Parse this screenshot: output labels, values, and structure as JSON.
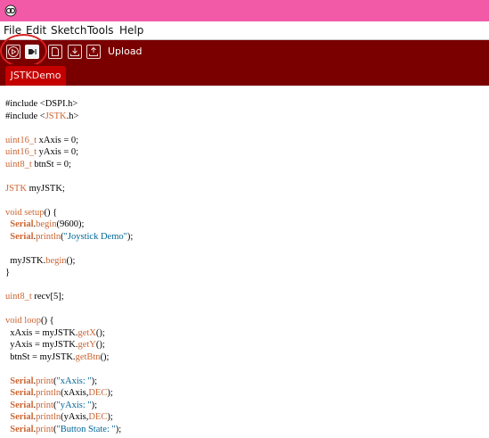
{
  "titlebar": {
    "logo_icon": "app-logo-icon"
  },
  "menubar": {
    "items": [
      {
        "label": "File"
      },
      {
        "label": "Edit"
      },
      {
        "label": "Sketch"
      },
      {
        "label": "Tools"
      },
      {
        "label": "Help"
      }
    ]
  },
  "toolbar": {
    "buttons": [
      {
        "icon": "play-icon"
      },
      {
        "icon": "stop-icon"
      },
      {
        "icon": "new-file-icon"
      },
      {
        "icon": "open-icon"
      },
      {
        "icon": "save-icon"
      }
    ],
    "status_label": "Upload",
    "accent_color": "#7a0000",
    "highlight_color": "#d92020"
  },
  "tabs": [
    {
      "label": "JSTKDemo"
    }
  ],
  "code": {
    "lines": [
      [
        {
          "t": "#include <DSPI.h>",
          "c": "dir"
        }
      ],
      [
        {
          "t": "#include <",
          "c": "dir"
        },
        {
          "t": "JSTK",
          "c": "kw-class"
        },
        {
          "t": ".h>",
          "c": "dir"
        }
      ],
      [],
      [
        {
          "t": "uint16_t",
          "c": "kw-type"
        },
        {
          "t": " xAxis = 0;",
          "c": ""
        }
      ],
      [
        {
          "t": "uint16_t",
          "c": "kw-type"
        },
        {
          "t": " yAxis = 0;",
          "c": ""
        }
      ],
      [
        {
          "t": "uint8_t",
          "c": "kw-type"
        },
        {
          "t": " btnSt = 0;",
          "c": ""
        }
      ],
      [],
      [
        {
          "t": "JSTK",
          "c": "kw-class"
        },
        {
          "t": " myJSTK;",
          "c": ""
        }
      ],
      [],
      [
        {
          "t": "void",
          "c": "kw-type"
        },
        {
          "t": " ",
          "c": ""
        },
        {
          "t": "setup",
          "c": "kw-func"
        },
        {
          "t": "() {",
          "c": ""
        }
      ],
      [
        {
          "t": "  ",
          "c": ""
        },
        {
          "t": "Serial",
          "c": "kw-bold"
        },
        {
          "t": ".",
          "c": ""
        },
        {
          "t": "begin",
          "c": "kw-func"
        },
        {
          "t": "(9600);",
          "c": ""
        }
      ],
      [
        {
          "t": "  ",
          "c": ""
        },
        {
          "t": "Serial",
          "c": "kw-bold"
        },
        {
          "t": ".",
          "c": ""
        },
        {
          "t": "println",
          "c": "kw-func"
        },
        {
          "t": "(",
          "c": ""
        },
        {
          "t": "\"Joystick Demo\"",
          "c": "str"
        },
        {
          "t": ");",
          "c": ""
        }
      ],
      [],
      [
        {
          "t": "  myJSTK.",
          "c": ""
        },
        {
          "t": "begin",
          "c": "kw-func"
        },
        {
          "t": "();",
          "c": ""
        }
      ],
      [
        {
          "t": "}",
          "c": ""
        }
      ],
      [],
      [
        {
          "t": "uint8_t",
          "c": "kw-type"
        },
        {
          "t": " recv[5];",
          "c": ""
        }
      ],
      [],
      [
        {
          "t": "void",
          "c": "kw-type"
        },
        {
          "t": " ",
          "c": ""
        },
        {
          "t": "loop",
          "c": "kw-func"
        },
        {
          "t": "() {",
          "c": ""
        }
      ],
      [
        {
          "t": "  xAxis = myJSTK.",
          "c": ""
        },
        {
          "t": "getX",
          "c": "kw-func"
        },
        {
          "t": "();",
          "c": ""
        }
      ],
      [
        {
          "t": "  yAxis = myJSTK.",
          "c": ""
        },
        {
          "t": "getY",
          "c": "kw-func"
        },
        {
          "t": "();",
          "c": ""
        }
      ],
      [
        {
          "t": "  btnSt = myJSTK.",
          "c": ""
        },
        {
          "t": "getBtn",
          "c": "kw-func"
        },
        {
          "t": "();",
          "c": ""
        }
      ],
      [],
      [
        {
          "t": "  ",
          "c": ""
        },
        {
          "t": "Serial",
          "c": "kw-bold"
        },
        {
          "t": ".",
          "c": ""
        },
        {
          "t": "print",
          "c": "kw-func"
        },
        {
          "t": "(",
          "c": ""
        },
        {
          "t": "\"xAxis: \"",
          "c": "str"
        },
        {
          "t": ");",
          "c": ""
        }
      ],
      [
        {
          "t": "  ",
          "c": ""
        },
        {
          "t": "Serial",
          "c": "kw-bold"
        },
        {
          "t": ".",
          "c": ""
        },
        {
          "t": "println",
          "c": "kw-func"
        },
        {
          "t": "(xAxis,",
          "c": ""
        },
        {
          "t": "DEC",
          "c": "kw-type"
        },
        {
          "t": ");",
          "c": ""
        }
      ],
      [
        {
          "t": "  ",
          "c": ""
        },
        {
          "t": "Serial",
          "c": "kw-bold"
        },
        {
          "t": ".",
          "c": ""
        },
        {
          "t": "print",
          "c": "kw-func"
        },
        {
          "t": "(",
          "c": ""
        },
        {
          "t": "\"yAxis: \"",
          "c": "str"
        },
        {
          "t": ");",
          "c": ""
        }
      ],
      [
        {
          "t": "  ",
          "c": ""
        },
        {
          "t": "Serial",
          "c": "kw-bold"
        },
        {
          "t": ".",
          "c": ""
        },
        {
          "t": "println",
          "c": "kw-func"
        },
        {
          "t": "(yAxis,",
          "c": ""
        },
        {
          "t": "DEC",
          "c": "kw-type"
        },
        {
          "t": ");",
          "c": ""
        }
      ],
      [
        {
          "t": "  ",
          "c": ""
        },
        {
          "t": "Serial",
          "c": "kw-bold"
        },
        {
          "t": ".",
          "c": ""
        },
        {
          "t": "print",
          "c": "kw-func"
        },
        {
          "t": "(",
          "c": ""
        },
        {
          "t": "\"Button State: \"",
          "c": "str"
        },
        {
          "t": ");",
          "c": ""
        }
      ]
    ]
  }
}
